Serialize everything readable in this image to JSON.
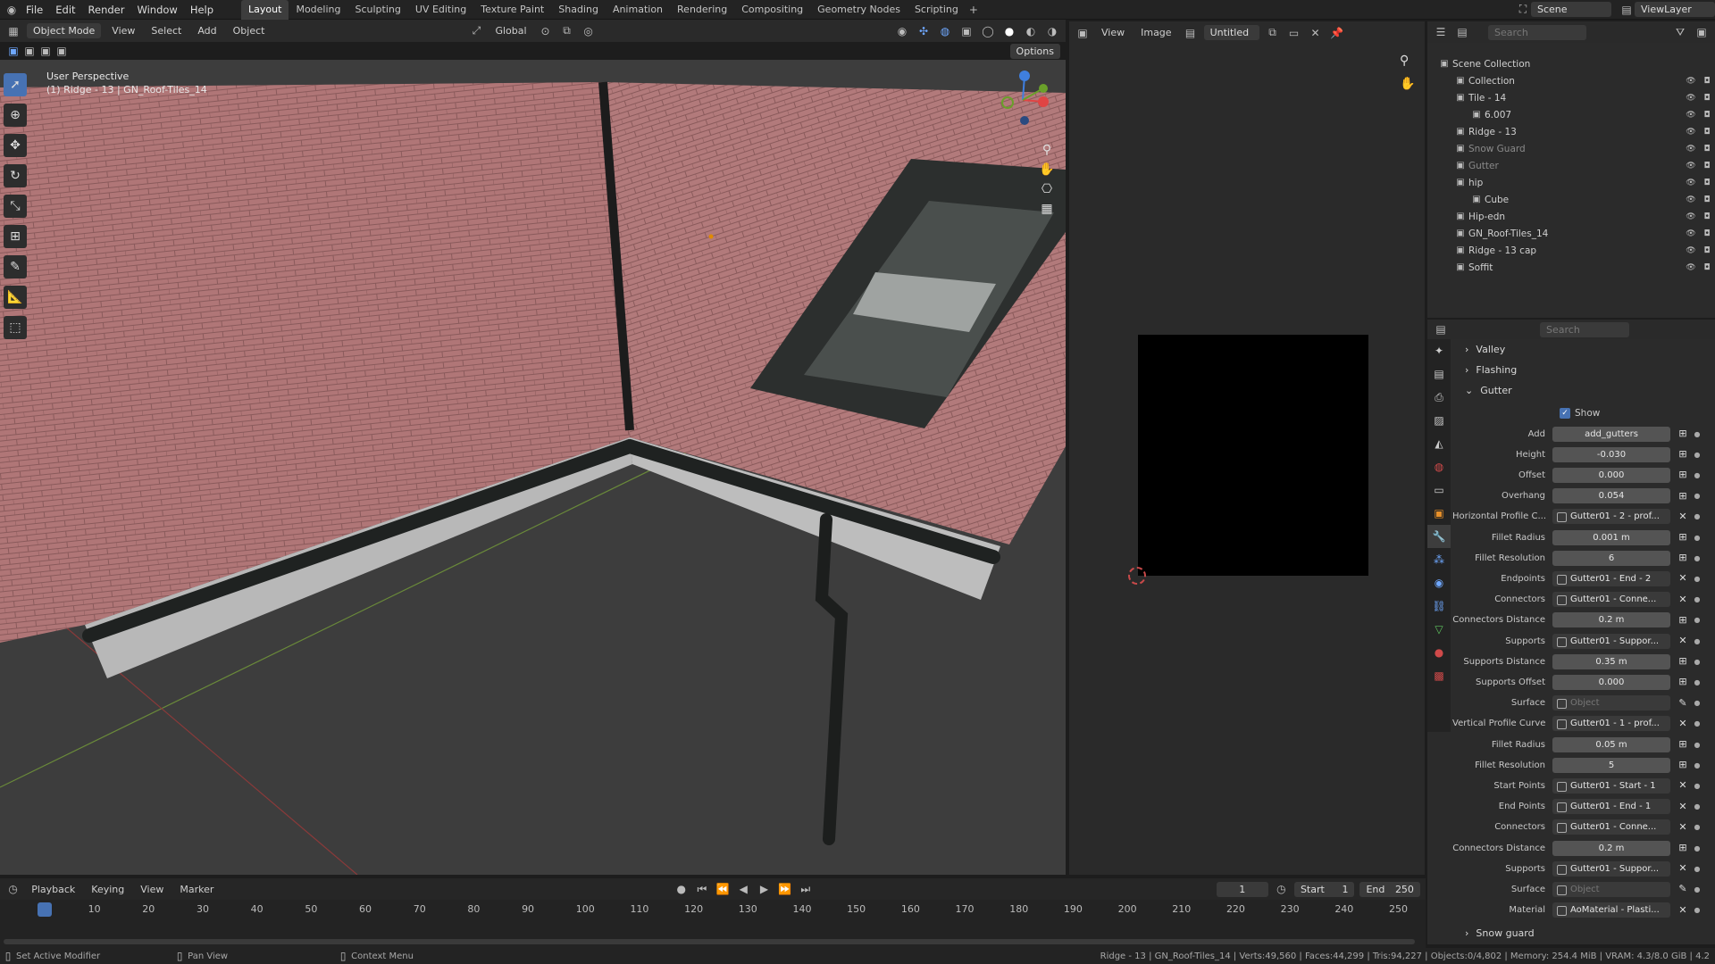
{
  "topbar": {
    "menus": [
      "File",
      "Edit",
      "Render",
      "Window",
      "Help"
    ],
    "workspaces": [
      "Layout",
      "Modeling",
      "Sculpting",
      "UV Editing",
      "Texture Paint",
      "Shading",
      "Animation",
      "Rendering",
      "Compositing",
      "Geometry Nodes",
      "Scripting"
    ],
    "scene": "Scene",
    "viewlayer": "ViewLayer"
  },
  "viewport": {
    "mode": "Object Mode",
    "menus": [
      "View",
      "Select",
      "Add",
      "Object"
    ],
    "orientation": "Global",
    "options": "Options",
    "perspective": "User Perspective",
    "active": "(1) Ridge - 13 | GN_Roof-Tiles_14"
  },
  "image_editor": {
    "menus": [
      "View",
      "Image"
    ],
    "image_name": "Untitled"
  },
  "outliner": {
    "search_placeholder": "Search",
    "rows": [
      {
        "label": "Scene Collection",
        "indent": 0,
        "dim": false
      },
      {
        "label": "Collection",
        "indent": 1,
        "dim": false
      },
      {
        "label": "Tile - 14",
        "indent": 1,
        "dim": false
      },
      {
        "label": "6.007",
        "indent": 2,
        "dim": false
      },
      {
        "label": "Ridge - 13",
        "indent": 1,
        "dim": false
      },
      {
        "label": "Snow Guard",
        "indent": 1,
        "dim": true
      },
      {
        "label": "Gutter",
        "indent": 1,
        "dim": true
      },
      {
        "label": "hip",
        "indent": 1,
        "dim": false
      },
      {
        "label": "Cube",
        "indent": 2,
        "dim": false
      },
      {
        "label": "Hip-edn",
        "indent": 1,
        "dim": false
      },
      {
        "label": "GN_Roof-Tiles_14",
        "indent": 1,
        "dim": false
      },
      {
        "label": "Ridge - 13 cap",
        "indent": 1,
        "dim": false
      },
      {
        "label": "Soffit",
        "indent": 1,
        "dim": false
      }
    ]
  },
  "properties": {
    "search_placeholder": "Search",
    "sections": {
      "valley": "Valley",
      "flashing": "Flashing",
      "gutter": "Gutter",
      "snow_guard": "Snow guard"
    },
    "show_label": "Show",
    "fields": [
      {
        "label": "Add",
        "value": "add_gutters",
        "kind": "text"
      },
      {
        "label": "Height",
        "value": "-0.030",
        "kind": "num"
      },
      {
        "label": "Offset",
        "value": "0.000",
        "kind": "num"
      },
      {
        "label": "Overhang",
        "value": "0.054",
        "kind": "num"
      },
      {
        "label": "Horizontal Profile C...",
        "value": "Gutter01 - 2 - prof...",
        "kind": "obj"
      },
      {
        "label": "Fillet Radius",
        "value": "0.001 m",
        "kind": "num"
      },
      {
        "label": "Fillet Resolution",
        "value": "6",
        "kind": "num"
      },
      {
        "label": "Endpoints",
        "value": "Gutter01 - End - 2",
        "kind": "obj"
      },
      {
        "label": "Connectors",
        "value": "Gutter01 - Conne...",
        "kind": "obj"
      },
      {
        "label": "Connectors Distance",
        "value": "0.2 m",
        "kind": "num"
      },
      {
        "label": "Supports",
        "value": "Gutter01 - Suppor...",
        "kind": "obj"
      },
      {
        "label": "Supports Distance",
        "value": "0.35 m",
        "kind": "num"
      },
      {
        "label": "Supports Offset",
        "value": "0.000",
        "kind": "num"
      },
      {
        "label": "Surface",
        "value": "Object",
        "kind": "empty"
      },
      {
        "label": "Vertical Profile Curve",
        "value": "Gutter01 - 1 - prof...",
        "kind": "obj"
      },
      {
        "label": "Fillet Radius",
        "value": "0.05 m",
        "kind": "num"
      },
      {
        "label": "Fillet Resolution",
        "value": "5",
        "kind": "num"
      },
      {
        "label": "Start Points",
        "value": "Gutter01 - Start - 1",
        "kind": "obj"
      },
      {
        "label": "End Points",
        "value": "Gutter01 - End - 1",
        "kind": "obj"
      },
      {
        "label": "Connectors",
        "value": "Gutter01 - Conne...",
        "kind": "obj"
      },
      {
        "label": "Connectors Distance",
        "value": "0.2 m",
        "kind": "num"
      },
      {
        "label": "Supports",
        "value": "Gutter01 - Suppor...",
        "kind": "obj"
      },
      {
        "label": "Surface",
        "value": "Object",
        "kind": "empty"
      },
      {
        "label": "Material",
        "value": "AoMaterial - Plasti...",
        "kind": "obj"
      }
    ]
  },
  "timeline": {
    "menus": [
      "Playback",
      "Keying",
      "View",
      "Marker"
    ],
    "current": "1",
    "start_label": "Start",
    "start": "1",
    "end_label": "End",
    "end": "250",
    "ticks": [
      "1",
      "10",
      "20",
      "30",
      "40",
      "50",
      "60",
      "70",
      "80",
      "90",
      "100",
      "110",
      "120",
      "130",
      "140",
      "150",
      "160",
      "170",
      "180",
      "190",
      "200",
      "210",
      "220",
      "230",
      "240",
      "250"
    ]
  },
  "status": {
    "left": "Set Active Modifier",
    "mid": "Pan View",
    "ctx": "Context Menu",
    "right": "Ridge - 13 | GN_Roof-Tiles_14 | Verts:49,560 | Faces:44,299 | Tris:94,227 | Objects:0/4,802 | Memory: 254.4 MiB | VRAM: 4.3/8.0 GiB | 4.2"
  },
  "colors": {
    "accent": "#4772b3",
    "roof": "#b07677",
    "gutter": "#1f2221"
  }
}
